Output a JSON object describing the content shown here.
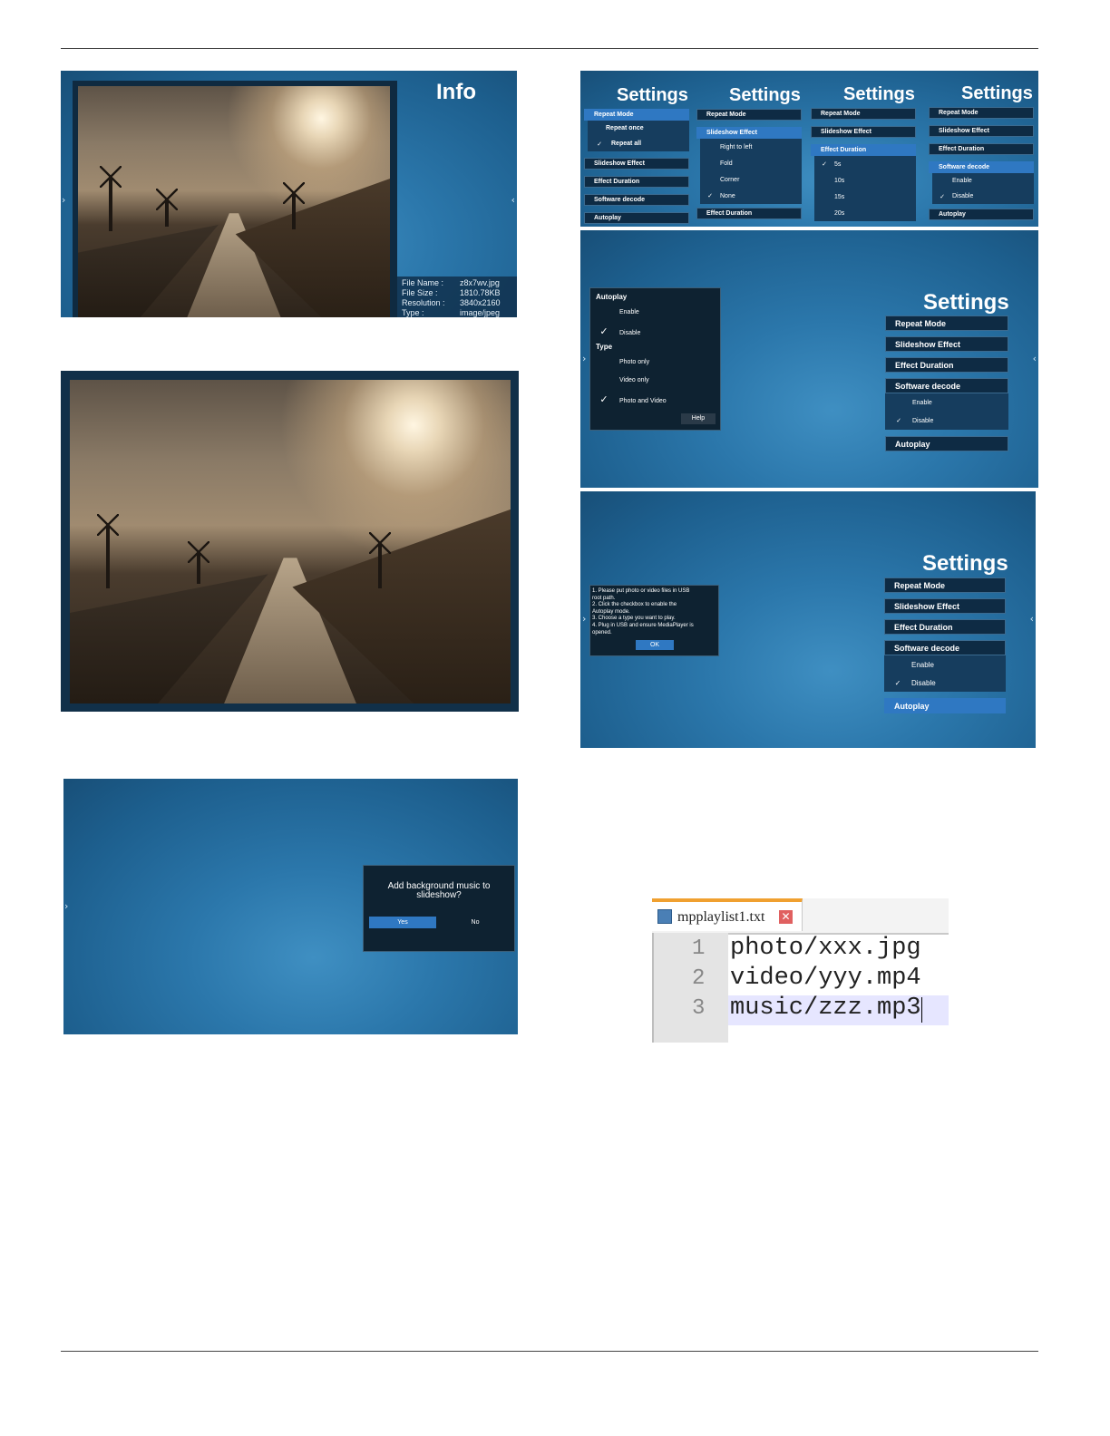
{
  "info_screen": {
    "title": "Info",
    "rows": [
      {
        "label": "File Name :",
        "value": "z8x7wv.jpg"
      },
      {
        "label": "File Size :",
        "value": "1810.78KB"
      },
      {
        "label": "Resolution :",
        "value": "3840x2160"
      },
      {
        "label": "Type :",
        "value": "image/jpeg"
      }
    ]
  },
  "settings_strip": [
    {
      "title": "Settings",
      "items": [
        "Repeat Mode",
        "Slideshow Effect",
        "Effect Duration",
        "Software decode",
        "Autoplay"
      ],
      "selected": "Repeat Mode",
      "options": [
        "Repeat once",
        "Repeat all"
      ],
      "checked": "Repeat all"
    },
    {
      "title": "Settings",
      "items": [
        "Repeat Mode",
        "Slideshow Effect",
        "Effect Duration"
      ],
      "selected": "Slideshow Effect",
      "options": [
        "Right to left",
        "Fold",
        "Corner",
        "None"
      ],
      "checked": "None"
    },
    {
      "title": "Settings",
      "items": [
        "Repeat Mode",
        "Slideshow Effect",
        "Effect Duration"
      ],
      "selected": "Effect Duration",
      "options": [
        "5s",
        "10s",
        "15s",
        "20s"
      ],
      "checked": "5s"
    },
    {
      "title": "Settings",
      "items": [
        "Repeat Mode",
        "Slideshow Effect",
        "Effect Duration",
        "Software decode",
        "Autoplay"
      ],
      "selected": "Software decode",
      "options": [
        "Enable",
        "Disable"
      ],
      "checked": "Disable"
    }
  ],
  "autoplay_screen": {
    "title": "Settings",
    "menu": [
      "Repeat Mode",
      "Slideshow Effect",
      "Effect Duration",
      "Software decode",
      "Autoplay"
    ],
    "submenu": [
      "Enable",
      "Disable"
    ],
    "submenu_checked": "Disable",
    "dialog": {
      "autoplay_label": "Autoplay",
      "autoplay_options": [
        "Enable",
        "Disable"
      ],
      "autoplay_checked": "Disable",
      "type_label": "Type",
      "type_options": [
        "Photo only",
        "Video only",
        "Photo and Video"
      ],
      "type_checked": "Photo and Video",
      "help_button": "Help"
    }
  },
  "help_screen": {
    "title": "Settings",
    "menu": [
      "Repeat Mode",
      "Slideshow Effect",
      "Effect Duration",
      "Software decode",
      "Autoplay"
    ],
    "submenu": [
      "Enable",
      "Disable"
    ],
    "submenu_checked": "Disable",
    "highlighted": "Autoplay",
    "dialog_lines": [
      "1. Please put photo or video files in USB",
      "root path.",
      "2. Click the checkbox to enable the",
      "Autoplay mode.",
      "3. Choose a type you want to play.",
      "4. Plug in USB and ensure MediaPlayer is",
      "opened."
    ],
    "ok_button": "OK"
  },
  "music_screen": {
    "question": "Add background music to slideshow?",
    "yes": "Yes",
    "no": "No"
  },
  "notepad": {
    "tab_name": "mpplaylist1.txt",
    "lines": [
      {
        "num": "1",
        "text": "photo/xxx.jpg"
      },
      {
        "num": "2",
        "text": "video/yyy.mp4"
      },
      {
        "num": "3",
        "text": "music/zzz.mp3"
      }
    ]
  },
  "colors": {
    "panel_blue": "#1d5f8e",
    "menu_dark": "#0e2b44",
    "menu_selected": "#2f78c2",
    "notepad_tab_accent": "#f0a030"
  }
}
